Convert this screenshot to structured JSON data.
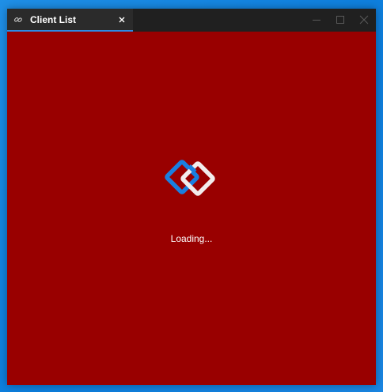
{
  "window": {
    "tab_title": "Client List",
    "tab_icon": "link-icon",
    "accent_color": "#2a8be4",
    "content_background": "#990000"
  },
  "controls": {
    "minimize_icon": "minimize-icon",
    "maximize_icon": "maximize-icon",
    "close_icon": "close-icon"
  },
  "splash": {
    "logo_icon": "chain-link-logo-icon",
    "logo_colors": [
      "#1a7fe0",
      "#f2ecec"
    ],
    "status_text": "Loading..."
  }
}
